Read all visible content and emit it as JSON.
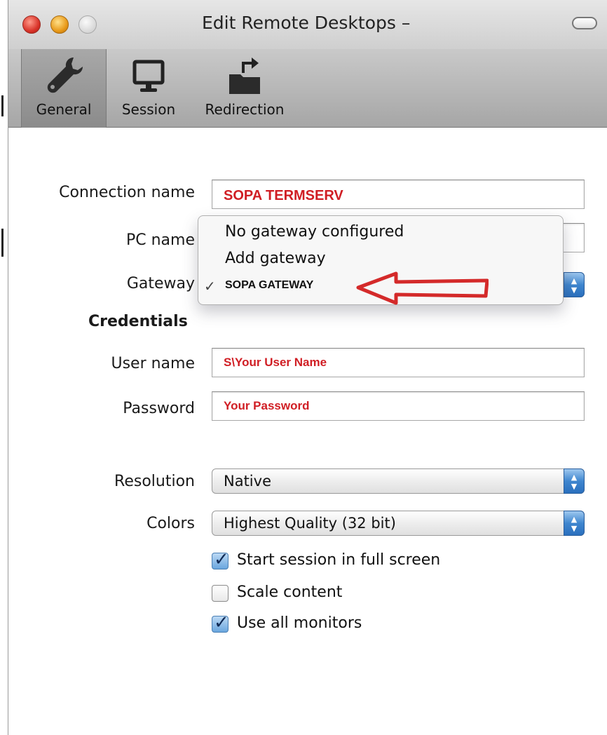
{
  "window": {
    "title": "Edit Remote Desktops –"
  },
  "toolbar": {
    "tabs": [
      {
        "label": "General",
        "icon": "wrench-icon",
        "selected": true
      },
      {
        "label": "Session",
        "icon": "monitor-icon",
        "selected": false
      },
      {
        "label": "Redirection",
        "icon": "folder-redirect-icon",
        "selected": false
      }
    ]
  },
  "form": {
    "connection_name": {
      "label": "Connection name",
      "value": "SOPA TERMSERV"
    },
    "pc_name": {
      "label": "PC name",
      "value": ""
    },
    "gateway": {
      "label": "Gateway",
      "selected": "SOPA GATEWAY"
    },
    "credentials_heading": "Credentials",
    "user_name": {
      "label": "User name",
      "value": "S\\Your User Name"
    },
    "password": {
      "label": "Password",
      "value": "Your Password"
    },
    "resolution": {
      "label": "Resolution",
      "value": "Native"
    },
    "colors": {
      "label": "Colors",
      "value": "Highest Quality (32 bit)"
    },
    "checkboxes": [
      {
        "label": "Start session in full screen",
        "checked": true
      },
      {
        "label": "Scale content",
        "checked": false
      },
      {
        "label": "Use all monitors",
        "checked": true
      }
    ]
  },
  "gateway_menu": {
    "items": [
      "No gateway configured",
      "Add gateway",
      "SOPA GATEWAY"
    ],
    "checked_index": 2
  },
  "colors": {
    "value_red": "#d01e24",
    "annotation_arrow": "#d42a2a",
    "stepper_blue": "#3f86cf"
  }
}
